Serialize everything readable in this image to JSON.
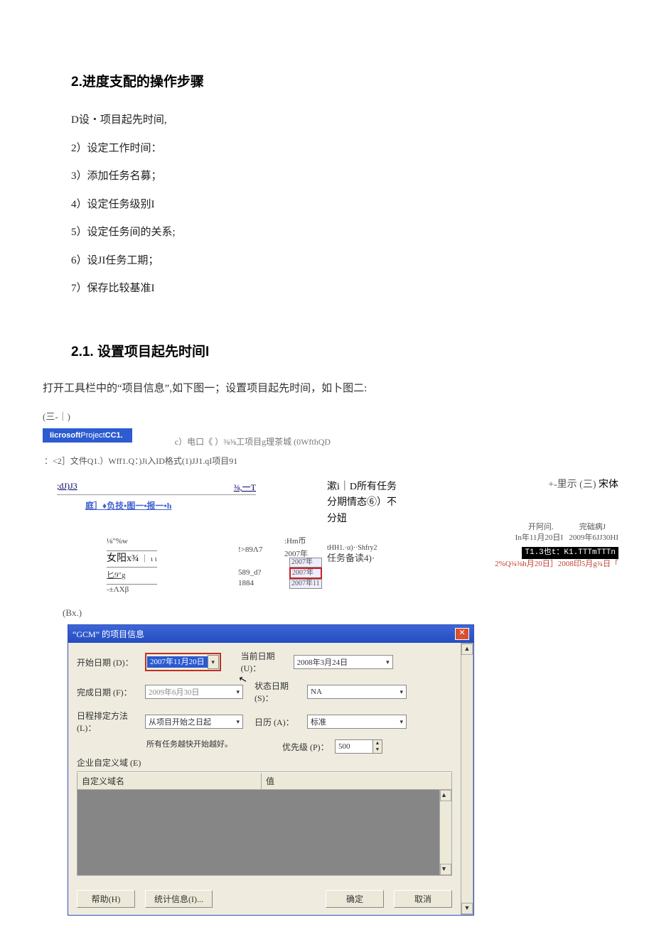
{
  "headings": {
    "h1": "2.进度支配的操作步骤",
    "h2": "2.1.   设置项目起先时间I"
  },
  "steps": {
    "s0": "D设・项目起先时间,",
    "s1": "2）设定工作时间：",
    "s2": "3）添加任务名募；",
    "s3": "4）设定任务级别I",
    "s4": "5）设定任务间的关系;",
    "s5": "6）设JI任务工期；",
    "s6": "7）保存比较基准I"
  },
  "body": {
    "p1": "打开工具栏中的“项目信息”,如下图一；设置项目起先时间，如卜图二:",
    "sub1": "(三-｜)",
    "sub2": "(Bx.)"
  },
  "fig1": {
    "bluebar_prefix": "Iicrosoft",
    "bluebar_mid": "Project",
    "bluebar_suffix": "CC1.",
    "filerow": "：<2］文件Q1.）Wff1.Q：)Ji入ID格式(1)JJ1.qI项目91",
    "rightnote": "c）电口《 ）⅜⅜工项目g理茶城  (0WfthQD",
    "grey_left": ";dJ)J3",
    "grey_right": "⅜,一T",
    "linkrow": "庭］♦负技•图一•报一•h",
    "mid1": "漱i｜D所有任务",
    "mid2": "分期情态⑥）不",
    "mid3": "分妞",
    "show": "+-里示 (三)",
    "songti": "宋体",
    "st1_a": "⅛\"%w",
    "st1_b": "女阳x¾",
    "st1_b2": "｜  ι   ι",
    "st1_c": "匕9\"g",
    "st1_d": "-±ΛXβ",
    "st2_a": "!>89Λ7",
    "st2_b": "589_d?",
    "st2_c": "1884",
    "st3": ":Hm币",
    "st4_a": "tHH1.·α)··Shfry2",
    "st4_b": "任务备读4)·",
    "yr0": "2007年",
    "yr1": "2007年",
    "yr2": "2007年",
    "yr3": "2007年11",
    "rb_a": "开阿问.",
    "rb_b": "完础病J",
    "rb_c": "In年11月20日I",
    "rb_d": "2009年6JJ30HI",
    "blackbar": "T1.3也t：K1.TTTmTTTn",
    "rb_e": "2%Q¾⅜h月20日］2008印5月g¾日「"
  },
  "dlg": {
    "title": "“GCM” 的项目信息",
    "lbl_start": "开始日期 (D)：",
    "val_start": "2007年11月20日",
    "lbl_cur": "当前日期 (U)：",
    "val_cur": "2008年3月24日",
    "lbl_finish": "完成日期 (F)：",
    "val_finish": "2009年6月30日",
    "lbl_status": "状态日期 (S)：",
    "val_status": "NA",
    "lbl_sched": "日程排定方法 (L)：",
    "val_sched": "从项目开始之日起",
    "lbl_cal": "日历 (A)：",
    "val_cal": "标准",
    "note": "所有任务越快开始越好。",
    "lbl_pri": "优先级 (P)：",
    "val_pri": "500",
    "lbl_cust": "企业自定义域 (E)",
    "gh1": "自定义域名",
    "gh2": "值",
    "btn_help": "帮助(H)",
    "btn_stat": "统计信息(I)...",
    "btn_ok": "确定",
    "btn_cancel": "取消"
  }
}
